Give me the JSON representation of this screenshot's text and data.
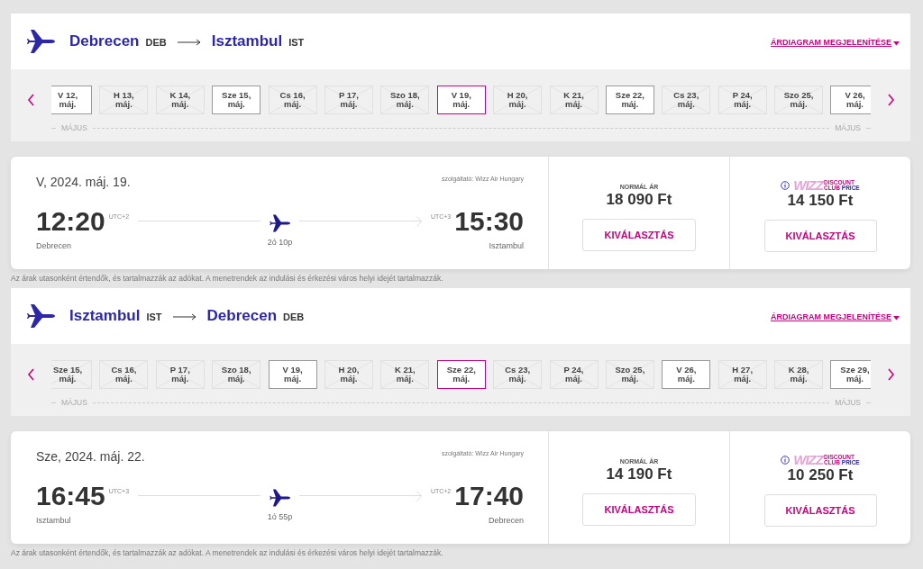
{
  "legs": [
    {
      "route": {
        "from_city": "Debrecen",
        "from_code": "DEB",
        "to_city": "Isztambul",
        "to_code": "IST"
      },
      "price_chart_link": "ÁRDIAGRAM MEGJELENÍTÉSE",
      "dates": [
        {
          "day": "V 12,",
          "month": "máj.",
          "available": true,
          "selected": false
        },
        {
          "day": "H 13,",
          "month": "máj.",
          "available": false,
          "selected": false
        },
        {
          "day": "K 14,",
          "month": "máj.",
          "available": false,
          "selected": false
        },
        {
          "day": "Sze 15,",
          "month": "máj.",
          "available": true,
          "selected": false
        },
        {
          "day": "Cs 16,",
          "month": "máj.",
          "available": false,
          "selected": false
        },
        {
          "day": "P 17,",
          "month": "máj.",
          "available": false,
          "selected": false
        },
        {
          "day": "Szo 18,",
          "month": "máj.",
          "available": false,
          "selected": false
        },
        {
          "day": "V 19,",
          "month": "máj.",
          "available": true,
          "selected": true
        },
        {
          "day": "H 20,",
          "month": "máj.",
          "available": false,
          "selected": false
        },
        {
          "day": "K 21,",
          "month": "máj.",
          "available": false,
          "selected": false
        },
        {
          "day": "Sze 22,",
          "month": "máj.",
          "available": true,
          "selected": false
        },
        {
          "day": "Cs 23,",
          "month": "máj.",
          "available": false,
          "selected": false
        },
        {
          "day": "P 24,",
          "month": "máj.",
          "available": false,
          "selected": false
        },
        {
          "day": "Szo 25,",
          "month": "máj.",
          "available": false,
          "selected": false
        },
        {
          "day": "V 26,",
          "month": "máj.",
          "available": true,
          "selected": false
        }
      ],
      "month_labels": [
        "MÁJUS",
        "MÁJUS"
      ],
      "flight": {
        "date": "V, 2024. máj. 19.",
        "operator": "szolgáltató: Wizz Air Hungary",
        "dep_time": "12:20",
        "dep_utc": "UTC+2",
        "arr_time": "15:30",
        "arr_utc": "UTC+3",
        "duration": "2ó 10p",
        "dep_city": "Debrecen",
        "arr_city": "Isztambul",
        "normal_label": "NORMÁL ÁR",
        "normal_price": "18 090 Ft",
        "discount_logo": {
          "brand": "WIZZ",
          "line1": "DISCOUNT",
          "club": "CLUB",
          "price": "PRICE"
        },
        "discount_price": "14 150 Ft",
        "normal_button": "KIVÁLASZTÁS",
        "discount_button": "KIVÁLASZTÁS"
      },
      "note": "Az árak utasonként értendők, és tartalmazzák az adókat. A menetrendek az indulási és érkezési város helyi idejét tartalmazzák."
    },
    {
      "route": {
        "from_city": "Isztambul",
        "from_code": "IST",
        "to_city": "Debrecen",
        "to_code": "DEB"
      },
      "price_chart_link": "ÁRDIAGRAM MEGJELENÍTÉSE",
      "dates": [
        {
          "day": "Sze 15,",
          "month": "máj.",
          "available": false,
          "selected": false
        },
        {
          "day": "Cs 16,",
          "month": "máj.",
          "available": false,
          "selected": false
        },
        {
          "day": "P 17,",
          "month": "máj.",
          "available": false,
          "selected": false
        },
        {
          "day": "Szo 18,",
          "month": "máj.",
          "available": false,
          "selected": false
        },
        {
          "day": "V 19,",
          "month": "máj.",
          "available": true,
          "selected": false
        },
        {
          "day": "H 20,",
          "month": "máj.",
          "available": false,
          "selected": false
        },
        {
          "day": "K 21,",
          "month": "máj.",
          "available": false,
          "selected": false
        },
        {
          "day": "Sze 22,",
          "month": "máj.",
          "available": true,
          "selected": true
        },
        {
          "day": "Cs 23,",
          "month": "máj.",
          "available": false,
          "selected": false
        },
        {
          "day": "P 24,",
          "month": "máj.",
          "available": false,
          "selected": false
        },
        {
          "day": "Szo 25,",
          "month": "máj.",
          "available": false,
          "selected": false
        },
        {
          "day": "V 26,",
          "month": "máj.",
          "available": true,
          "selected": false
        },
        {
          "day": "H 27,",
          "month": "máj.",
          "available": false,
          "selected": false
        },
        {
          "day": "K 28,",
          "month": "máj.",
          "available": false,
          "selected": false
        },
        {
          "day": "Sze 29,",
          "month": "máj.",
          "available": true,
          "selected": false
        }
      ],
      "month_labels": [
        "MÁJUS",
        "MÁJUS"
      ],
      "flight": {
        "date": "Sze, 2024. máj. 22.",
        "operator": "szolgáltató: Wizz Air Hungary",
        "dep_time": "16:45",
        "dep_utc": "UTC+3",
        "arr_time": "17:40",
        "arr_utc": "UTC+2",
        "duration": "1ó 55p",
        "dep_city": "Isztambul",
        "arr_city": "Debrecen",
        "normal_label": "NORMÁL ÁR",
        "normal_price": "14 190 Ft",
        "discount_logo": {
          "brand": "WIZZ",
          "line1": "DISCOUNT",
          "club": "CLUB",
          "price": "PRICE"
        },
        "discount_price": "10 250 Ft",
        "normal_button": "KIVÁLASZTÁS",
        "discount_button": "KIVÁLASZTÁS"
      },
      "note": "Az árak utasonként értendők, és tartalmazzák az adókat. A menetrendek az indulási és érkezési város helyi idejét tartalmazzák."
    }
  ]
}
